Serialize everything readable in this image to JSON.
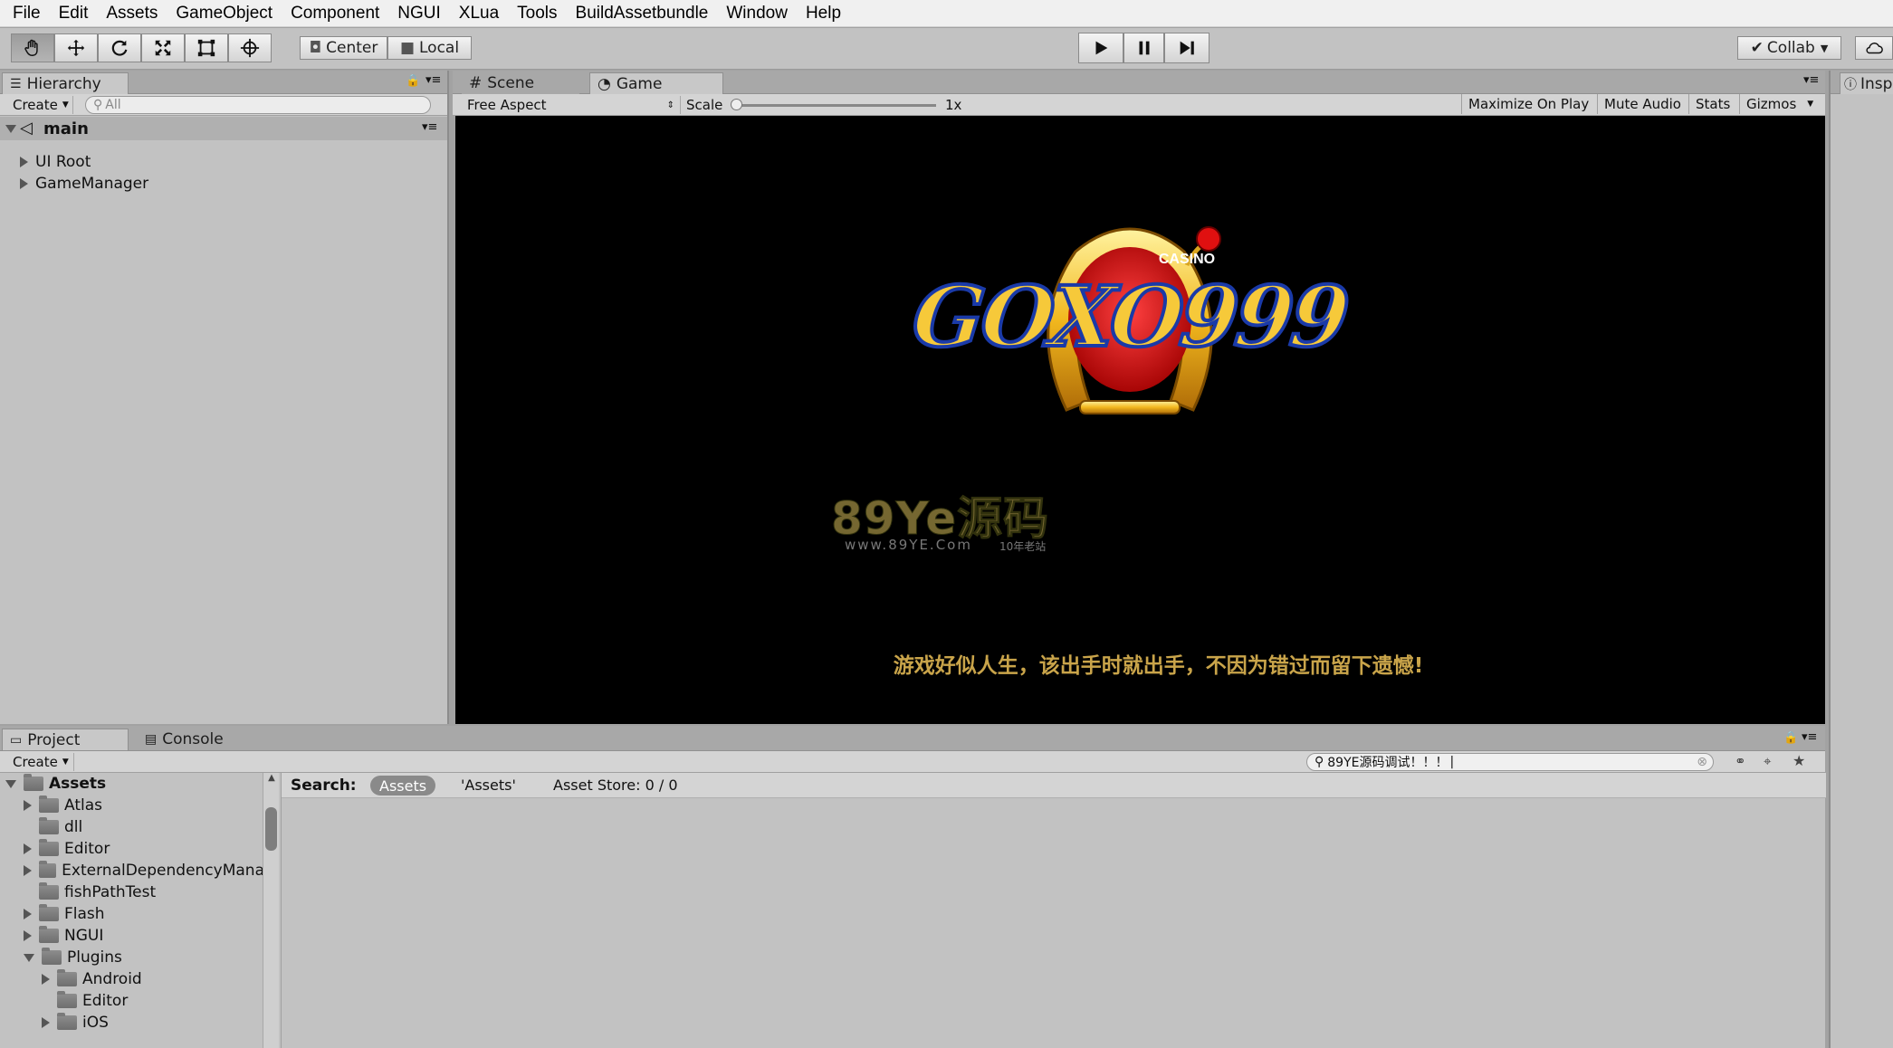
{
  "menu": [
    "File",
    "Edit",
    "Assets",
    "GameObject",
    "Component",
    "NGUI",
    "XLua",
    "Tools",
    "BuildAssetbundle",
    "Window",
    "Help"
  ],
  "toolbar": {
    "tools": [
      "hand-icon",
      "move-icon",
      "rotate-icon",
      "scale-icon",
      "rect-tool-icon",
      "transform-icon"
    ],
    "pivot": "Center",
    "space": "Local",
    "collab": "Collab"
  },
  "hierarchy": {
    "tab": "Hierarchy",
    "create": "Create",
    "search_placeholder": "All",
    "scene": "main",
    "items": [
      "UI Root",
      "GameManager"
    ]
  },
  "view_tabs": {
    "scene": "Scene",
    "game": "Game",
    "inspector": "Insp"
  },
  "game_bar": {
    "aspect": "Free Aspect",
    "scale_label": "Scale",
    "scale_value": "1x",
    "maximize": "Maximize On Play",
    "mute": "Mute Audio",
    "stats": "Stats",
    "gizmos": "Gizmos"
  },
  "game": {
    "logo_top": "CASINO",
    "logo_main": "GOXO999",
    "watermark_main": "89Ye源码",
    "watermark_url": "www.89YE.Com",
    "watermark_tag": "10年老站",
    "slogan": "游戏好似人生，该出手时就出手，不因为错过而留下遗憾!"
  },
  "project": {
    "tab": "Project",
    "console_tab": "Console",
    "create": "Create",
    "search_value": "89YE源码调试！！！",
    "search_label": "Search:",
    "filter_assets": "Assets",
    "filter_assets_quoted": "'Assets'",
    "asset_store": "Asset Store: 0 / 0",
    "tree": [
      {
        "label": "Assets",
        "level": 0,
        "arrow": "down",
        "bold": true
      },
      {
        "label": "Atlas",
        "level": 1,
        "arrow": "right"
      },
      {
        "label": "dll",
        "level": 1,
        "arrow": "none"
      },
      {
        "label": "Editor",
        "level": 1,
        "arrow": "right"
      },
      {
        "label": "ExternalDependencyMana",
        "level": 1,
        "arrow": "right"
      },
      {
        "label": "fishPathTest",
        "level": 1,
        "arrow": "none"
      },
      {
        "label": "Flash",
        "level": 1,
        "arrow": "right"
      },
      {
        "label": "NGUI",
        "level": 1,
        "arrow": "right"
      },
      {
        "label": "Plugins",
        "level": 1,
        "arrow": "down"
      },
      {
        "label": "Android",
        "level": 2,
        "arrow": "right"
      },
      {
        "label": "Editor",
        "level": 2,
        "arrow": "none"
      },
      {
        "label": "iOS",
        "level": 2,
        "arrow": "right"
      }
    ]
  }
}
